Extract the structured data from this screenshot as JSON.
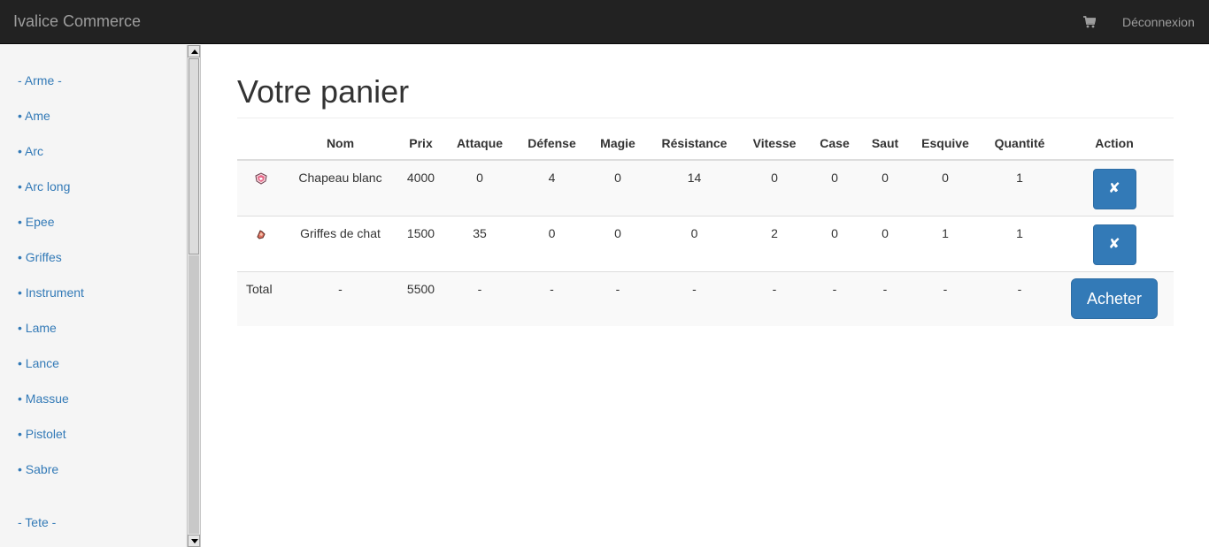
{
  "navbar": {
    "brand": "Ivalice Commerce",
    "cart_icon": "cart-icon",
    "logout_label": "Déconnexion"
  },
  "sidebar": {
    "items": [
      {
        "label": "- Arme -"
      },
      {
        "label": "• Ame"
      },
      {
        "label": "• Arc"
      },
      {
        "label": "• Arc long"
      },
      {
        "label": "• Epee"
      },
      {
        "label": "• Griffes"
      },
      {
        "label": "• Instrument"
      },
      {
        "label": "• Lame"
      },
      {
        "label": "• Lance"
      },
      {
        "label": "• Massue"
      },
      {
        "label": "• Pistolet"
      },
      {
        "label": "• Sabre"
      },
      {
        "label": "- Tete -"
      }
    ]
  },
  "main": {
    "title": "Votre panier",
    "table": {
      "headers": [
        "",
        "Nom",
        "Prix",
        "Attaque",
        "Défense",
        "Magie",
        "Résistance",
        "Vitesse",
        "Case",
        "Saut",
        "Esquive",
        "Quantité",
        "Action"
      ],
      "rows": [
        {
          "icon": "hat-item-icon",
          "nom": "Chapeau blanc",
          "prix": "4000",
          "attaque": "0",
          "defense": "4",
          "magie": "0",
          "resistance": "14",
          "vitesse": "0",
          "case": "0",
          "saut": "0",
          "esquive": "0",
          "quantite": "1",
          "action": "✘"
        },
        {
          "icon": "claws-item-icon",
          "nom": "Griffes de chat",
          "prix": "1500",
          "attaque": "35",
          "defense": "0",
          "magie": "0",
          "resistance": "0",
          "vitesse": "2",
          "case": "0",
          "saut": "0",
          "esquive": "1",
          "quantite": "1",
          "action": "✘"
        }
      ],
      "total": {
        "label": "Total",
        "nom": "-",
        "prix": "5500",
        "attaque": "-",
        "defense": "-",
        "magie": "-",
        "resistance": "-",
        "vitesse": "-",
        "case": "-",
        "saut": "-",
        "esquive": "-",
        "quantite": "-",
        "buy_label": "Acheter"
      }
    }
  },
  "colors": {
    "navbar_bg": "#222222",
    "link": "#337ab7",
    "button": "#337ab7",
    "sidebar_bg": "#f5f5f5"
  }
}
